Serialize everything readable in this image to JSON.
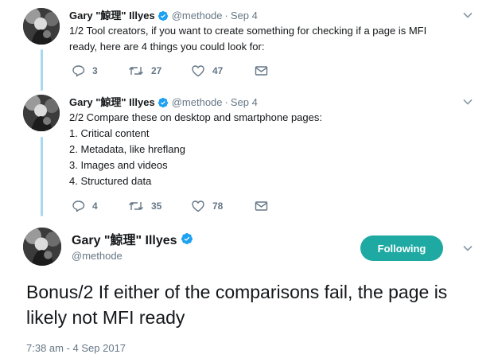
{
  "tweets": [
    {
      "name": "Gary \"鯨理\" Illyes",
      "handle": "@methode",
      "date": "Sep 4",
      "lines": [
        "1/2 Tool creators, if you want to create something for checking if a page is MFI",
        "ready, here are 4 things you could look for:"
      ],
      "replies": "3",
      "retweets": "27",
      "likes": "47"
    },
    {
      "name": "Gary \"鯨理\" Illyes",
      "handle": "@methode",
      "date": "Sep 4",
      "lines": [
        "2/2 Compare these on desktop and smartphone pages:",
        "1. Critical content",
        "2. Metadata, like hreflang",
        "3. Images and videos",
        "4. Structured data"
      ],
      "replies": "4",
      "retweets": "35",
      "likes": "78"
    }
  ],
  "main_tweet": {
    "name": "Gary \"鯨理\" Illyes",
    "handle": "@methode",
    "follow_label": "Following",
    "text": "Bonus/2 If either of the comparisons fail, the page is likely not MFI ready",
    "timestamp": "7:38 am - 4 Sep 2017"
  },
  "colors": {
    "verified": "#1da1f2",
    "follow_button": "#1eaaa2",
    "thread_line": "#a7d8f0",
    "secondary_text": "#657786"
  },
  "icons": [
    "reply-icon",
    "retweet-icon",
    "like-icon",
    "dm-icon",
    "verified-icon",
    "chevron-down-icon"
  ]
}
